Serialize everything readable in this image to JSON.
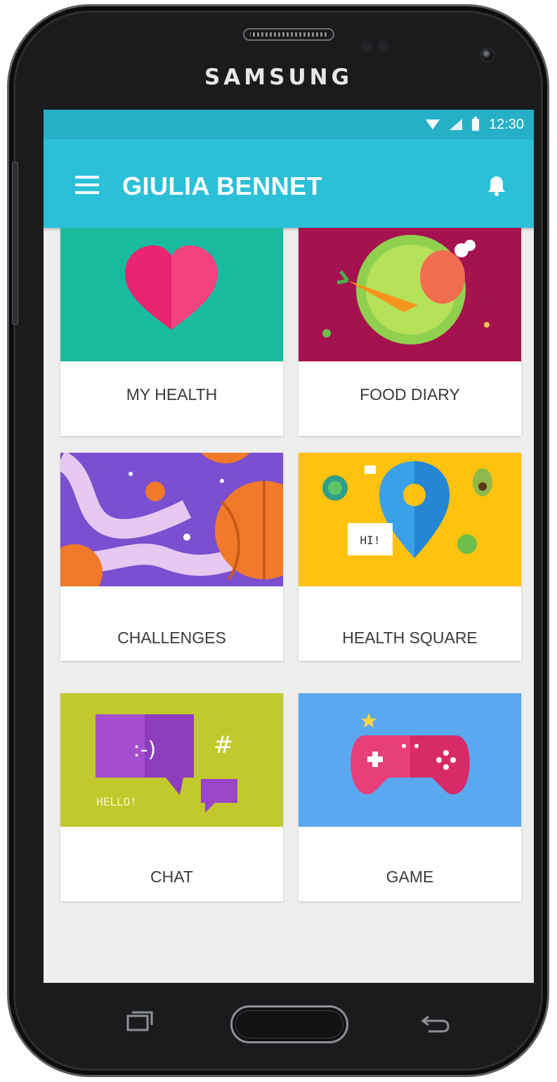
{
  "device": {
    "brand": "SAMSUNG"
  },
  "status_bar": {
    "time": "12:30"
  },
  "toolbar": {
    "title": "GIULIA BENNET",
    "menu_icon": "hamburger-menu-icon",
    "notification_icon": "bell-icon"
  },
  "tiles": [
    {
      "label": "MY HEALTH",
      "art_color": "#19bba0",
      "icon": "heart-icon"
    },
    {
      "label": "FOOD DIARY",
      "art_color": "#a5124f",
      "icon": "plate-icon"
    },
    {
      "label": "CHALLENGES",
      "art_color": "#7a4fd0",
      "icon": "tentacle-ball-icon"
    },
    {
      "label": "HEALTH SQUARE",
      "art_color": "#ffc20e",
      "icon": "map-pin-icon"
    },
    {
      "label": "CHAT",
      "art_color": "#c2c92c",
      "icon": "chat-bubble-icon"
    },
    {
      "label": "GAME",
      "art_color": "#5aa9f0",
      "icon": "gamepad-icon"
    }
  ],
  "art_text": {
    "health_square_bubble": "HI!",
    "chat_smiley": ":-)",
    "chat_hash": "#",
    "chat_hello": "HELLO!"
  },
  "nav_keys": {
    "recent": "recent-apps-icon",
    "home": "home-button",
    "back": "back-icon"
  },
  "colors": {
    "status_bar": "#26b0c8",
    "toolbar": "#2cc0d8",
    "background": "#eeeeee",
    "label_text": "#3a3a3a"
  }
}
